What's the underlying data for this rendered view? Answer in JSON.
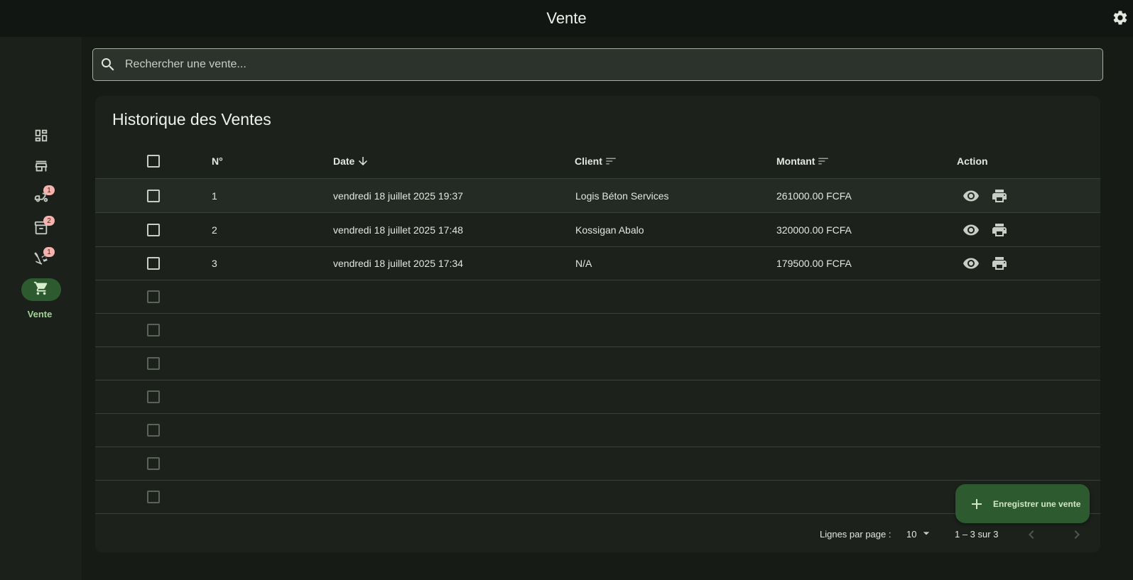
{
  "app": {
    "title": "Vente"
  },
  "rail": {
    "items": [
      {
        "icon": "dashboard-icon",
        "badge": ""
      },
      {
        "icon": "store-icon",
        "badge": ""
      },
      {
        "icon": "delivery-icon",
        "badge": "1"
      },
      {
        "icon": "archive-icon",
        "badge": "2"
      },
      {
        "icon": "dolly-icon",
        "badge": "1"
      },
      {
        "icon": "cart-icon",
        "badge": "",
        "label": "Vente",
        "active": true
      }
    ]
  },
  "search": {
    "placeholder": "Rechercher une vente..."
  },
  "history": {
    "title": "Historique des Ventes",
    "columns": {
      "number": "N°",
      "date": "Date",
      "client": "Client",
      "amount": "Montant",
      "action": "Action"
    },
    "rows": [
      {
        "number": "1",
        "date": "vendredi 18 juillet 2025 19:37",
        "client": "Logis Béton Services",
        "amount": "261000.00 FCFA"
      },
      {
        "number": "2",
        "date": "vendredi 18 juillet 2025 17:48",
        "client": "Kossigan Abalo",
        "amount": "320000.00 FCFA"
      },
      {
        "number": "3",
        "date": "vendredi 18 juillet 2025 17:34",
        "client": "N/A",
        "amount": "179500.00 FCFA"
      }
    ],
    "empty_rows": 7
  },
  "pagination": {
    "rows_per_page_label": "Lignes par page :",
    "rows_per_page": "10",
    "range": "1 – 3 sur 3"
  },
  "fab": {
    "label": "Enregistrer une vente"
  },
  "colors": {
    "accent": "#2d5a2e",
    "accent_text": "#a3d494",
    "badge": "#f4b4ad"
  }
}
